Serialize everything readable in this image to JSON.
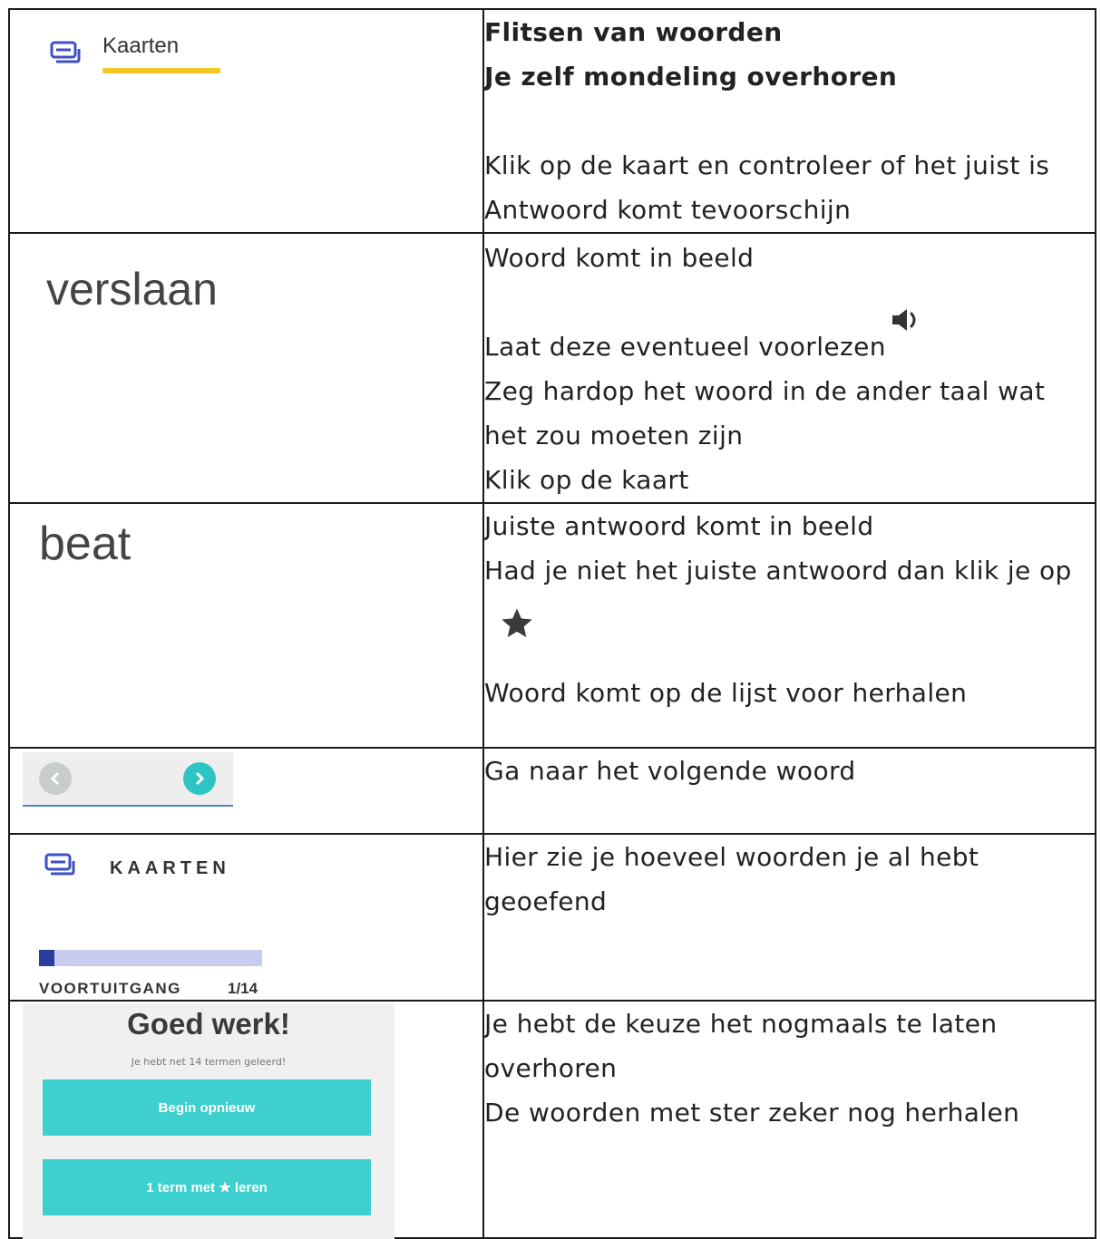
{
  "row1": {
    "tab_label": "Kaarten",
    "heading1": "Flitsen van woorden",
    "heading2": "Je zelf mondeling overhoren",
    "line1": "Klik op de kaart en controleer of het juist is",
    "line2": "Antwoord komt tevoorschijn"
  },
  "row2": {
    "word": "verslaan",
    "line1": "Woord komt in beeld",
    "line2": "Laat deze eventueel voorlezen",
    "line3": "Zeg hardop het woord in de ander taal wat",
    "line4": "het zou moeten zijn",
    "line5": "Klik op de kaart",
    "icon": "speaker-icon"
  },
  "row3": {
    "word": "beat",
    "line1": "Juiste antwoord komt in beeld",
    "line2": "Had je niet het juiste antwoord dan klik je op",
    "line3": "Woord komt op de lijst voor herhalen",
    "icon": "star-icon"
  },
  "row4": {
    "line1": "Ga naar het volgende woord"
  },
  "row5": {
    "tab_label": "KAARTEN",
    "progress_label": "VOORTUITGANG",
    "progress_count": "1/14",
    "progress_fraction": 0.071,
    "line1": "Hier zie je hoeveel woorden je al hebt",
    "line2": "geoefend"
  },
  "row6": {
    "title": "Goed werk!",
    "subtitle": "Je hebt net 14 termen geleerd!",
    "button1": "Begin opnieuw",
    "button2": "1 term met ★ leren",
    "line1": "Je hebt de keuze het nogmaals te laten",
    "line2": "overhoren",
    "line3": "De woorden met ster zeker nog herhalen"
  },
  "colors": {
    "accent_yellow": "#f3c623",
    "teal": "#2ec4c4",
    "button_teal": "#3ecfcf",
    "progress_fill": "#2c3e9c",
    "progress_track": "#c8cdf0",
    "icon_blue": "#3d4fc4"
  }
}
